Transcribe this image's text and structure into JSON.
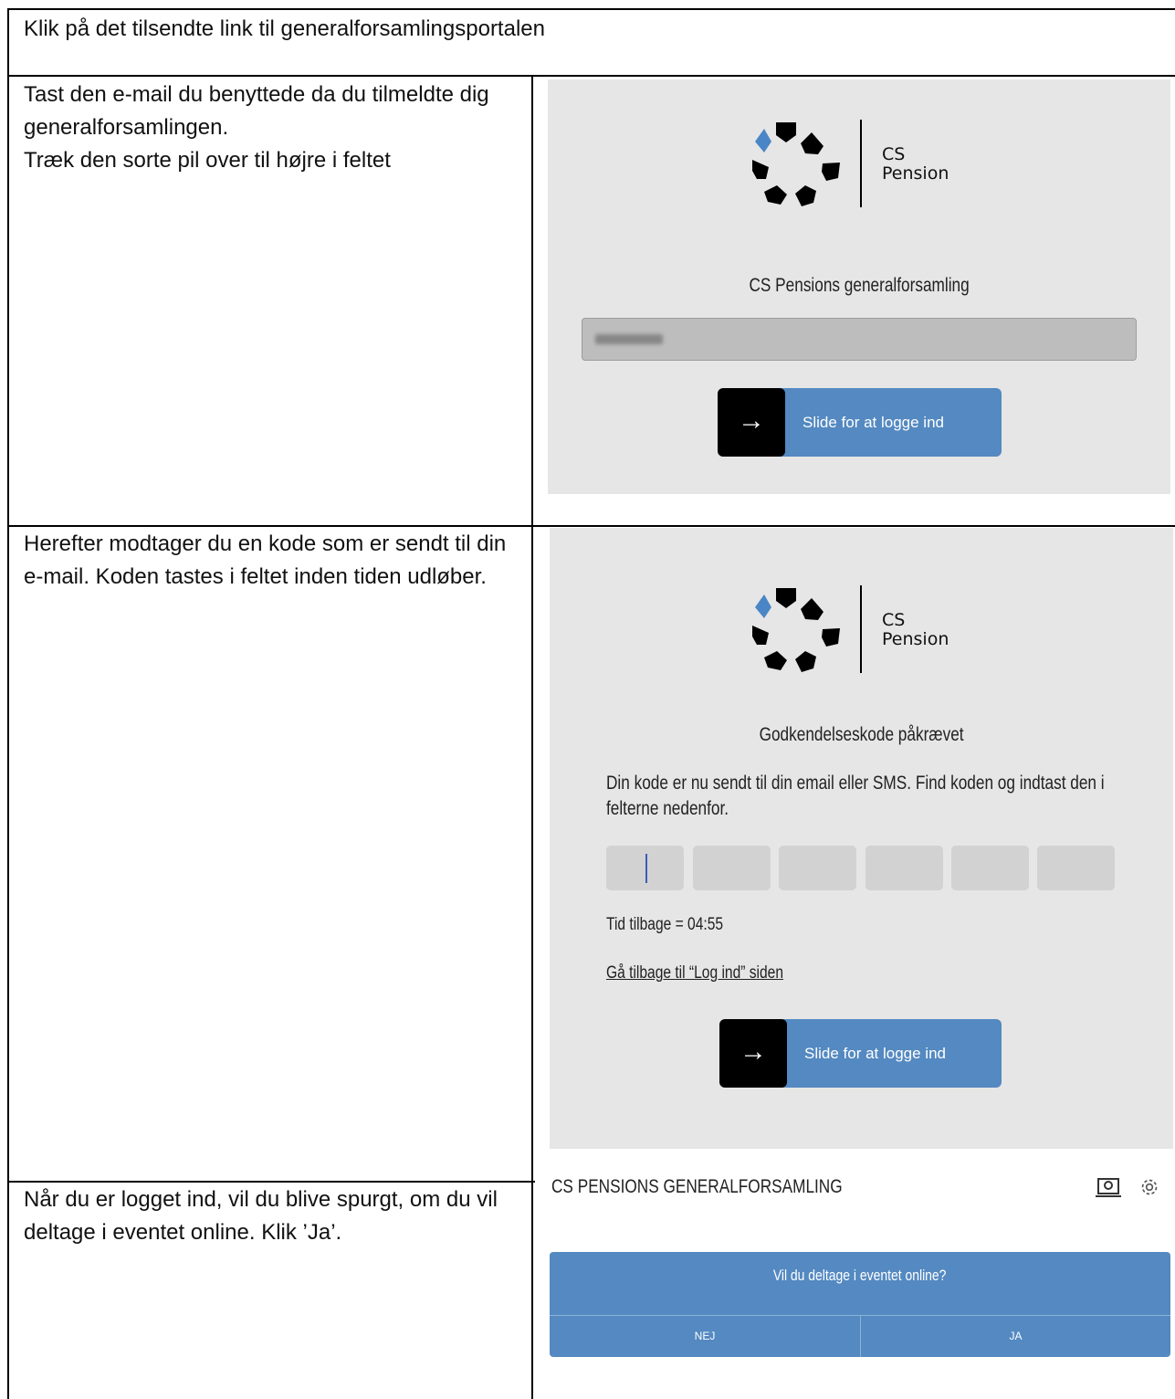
{
  "row1": {
    "text": "Klik på det tilsendte link til generalforsamlingsportalen"
  },
  "row2": {
    "instructions": [
      "Tast den e-mail du benyttede da du tilmeldte dig generalforsamlingen.",
      "Træk den sorte pil over til højre i feltet"
    ],
    "logo": {
      "line1": "CS",
      "line2": "Pension"
    },
    "heading": "CS Pensions generalforsamling",
    "slider_label": "Slide for at logge ind"
  },
  "row3": {
    "instructions": "Herefter modtager du en kode som er sendt til din e-mail. Koden tastes i feltet inden tiden udløber.",
    "logo": {
      "line1": "CS",
      "line2": "Pension"
    },
    "heading": "Godkendelseskode påkrævet",
    "message": "Din kode er nu sendt til din email eller SMS. Find koden og indtast den i felterne nedenfor.",
    "timer": "Tid tilbage = 04:55",
    "back_link": "Gå tilbage til “Log ind” siden",
    "slider_label": "Slide for at logge ind"
  },
  "row4": {
    "instructions": "Når du er logget ind, vil du blive spurgt, om du vil deltage i eventet online. Klik ’Ja’.",
    "app_title": "CS PENSIONS GENERALFORSAMLING",
    "question": "Vil du deltage i eventet online?",
    "no_label": "NEJ",
    "yes_label": "JA"
  },
  "colors": {
    "brand_blue": "#5489c1",
    "panel_gray": "#e6e6e6",
    "logo_accent": "#4a86c6"
  },
  "icons": [
    "cs-pension-logo",
    "arrow-right-icon",
    "presenter-icon",
    "gear-icon"
  ]
}
